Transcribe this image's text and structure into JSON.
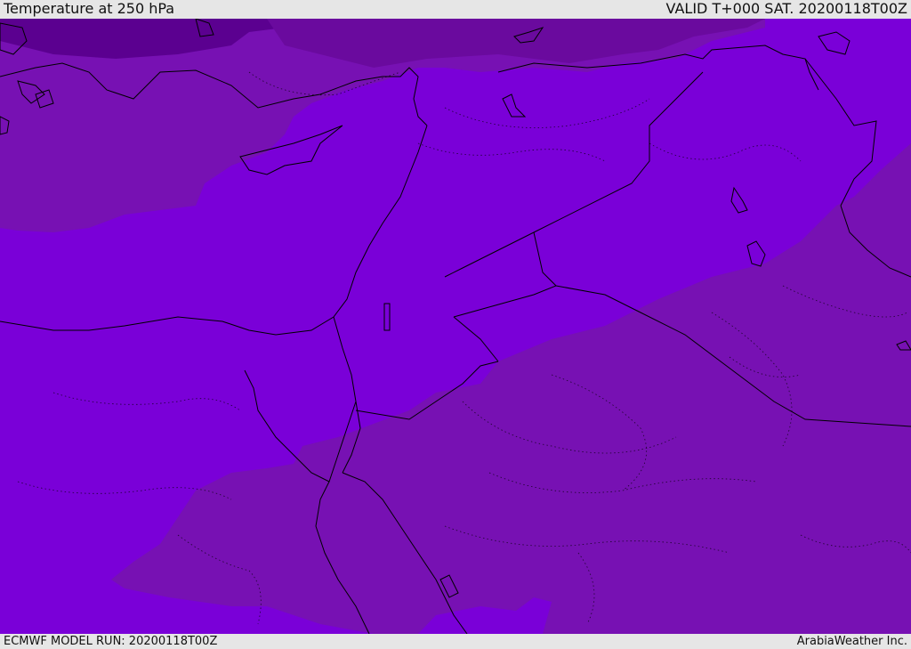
{
  "header": {
    "title": "Temperature at 250 hPa",
    "valid": "VALID T+000 SAT. 20200118T00Z"
  },
  "footer": {
    "model_run": "ECMWF MODEL RUN: 20200118T00Z",
    "credit": "ArabiaWeather Inc."
  },
  "map": {
    "fill_colors": {
      "warm_band": "#7a00d8",
      "mid_band": "#7711b3",
      "cold_band": "#6a0a9e",
      "coldest_band": "#5b0090"
    },
    "border_color": "#000000"
  }
}
